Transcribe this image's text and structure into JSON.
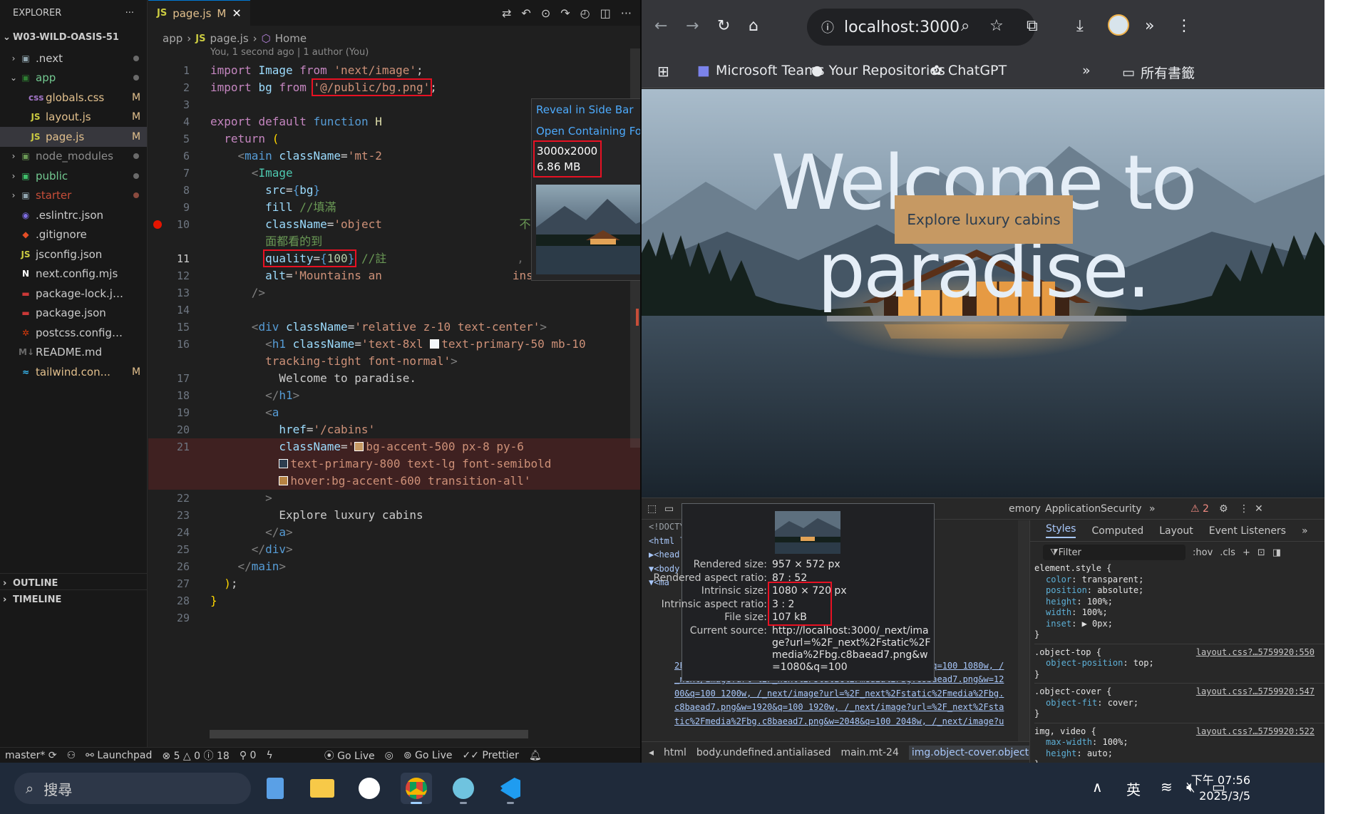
{
  "vscode": {
    "explorer": {
      "header": "EXPLORER",
      "project": "W03-WILD-OASIS-51",
      "items": [
        {
          "label": ".next",
          "icon": "folder",
          "indent": 1,
          "expanded": false,
          "status": "dot"
        },
        {
          "label": "app",
          "icon": "folder-app",
          "indent": 1,
          "expanded": true,
          "status": "dot",
          "color": "#73c991"
        },
        {
          "label": "globals.css",
          "icon": "css",
          "indent": 2,
          "status": "M",
          "color": "#e2c08d"
        },
        {
          "label": "layout.js",
          "icon": "js",
          "indent": 2,
          "status": "M",
          "color": "#e2c08d"
        },
        {
          "label": "page.js",
          "icon": "js",
          "indent": 2,
          "status": "M",
          "color": "#e2c08d",
          "active": true
        },
        {
          "label": "node_modules",
          "icon": "folder-node",
          "indent": 1,
          "expanded": false,
          "status": "dot",
          "color": "#8c8c8c"
        },
        {
          "label": "public",
          "icon": "folder-public",
          "indent": 1,
          "expanded": false,
          "status": "dot",
          "color": "#73c991"
        },
        {
          "label": "starter",
          "icon": "folder",
          "indent": 1,
          "expanded": false,
          "status": "dot",
          "color": "#c74e39"
        },
        {
          "label": ".eslintrc.json",
          "icon": "eslint",
          "indent": 1,
          "status": ""
        },
        {
          "label": ".gitignore",
          "icon": "git",
          "indent": 1,
          "status": ""
        },
        {
          "label": "jsconfig.json",
          "icon": "js",
          "indent": 1,
          "status": ""
        },
        {
          "label": "next.config.mjs",
          "icon": "next",
          "indent": 1,
          "status": ""
        },
        {
          "label": "package-lock.json",
          "icon": "npm",
          "indent": 1,
          "status": ""
        },
        {
          "label": "package.json",
          "icon": "npm",
          "indent": 1,
          "status": ""
        },
        {
          "label": "postcss.config.mjs",
          "icon": "postcss",
          "indent": 1,
          "status": ""
        },
        {
          "label": "README.md",
          "icon": "md",
          "indent": 1,
          "status": ""
        },
        {
          "label": "tailwind.con...",
          "icon": "tailwind",
          "indent": 1,
          "status": "M",
          "color": "#e2c08d"
        }
      ],
      "outline": "OUTLINE",
      "timeline": "TIMELINE"
    },
    "tab": {
      "icon": "JS",
      "name": "page.js",
      "status": "M"
    },
    "breadcrumb": {
      "folder": "app",
      "file_icon": "JS",
      "file": "page.js",
      "symbol": "Home"
    },
    "blame_header": "You, 1 second ago | 1 author (You)",
    "hover": {
      "link1": "Reveal in Side Bar",
      "link2": "Open Containing Folder",
      "dims": "3000x2000",
      "size": "6.86 MB"
    },
    "ghost_blame": "1 second ago",
    "statusbar": {
      "branch": "master*",
      "launchpad": "Launchpad",
      "errors": "5",
      "warnings": "0",
      "info": "18",
      "ports": "0",
      "golive1": "Go Live",
      "golive2": "Go Live",
      "prettier": "Prettier"
    }
  },
  "browser": {
    "url": "localhost:3000",
    "bookmarks": [
      "Microsoft Teams",
      "Your Repositories",
      "ChatGPT"
    ],
    "all_bookmarks": "所有書籤",
    "page": {
      "title": "Welcome to paradise.",
      "button": "Explore luxury cabins"
    },
    "devtools": {
      "tabs": [
        "emory",
        "Application",
        "Security"
      ],
      "warnings": "2",
      "side_tabs": [
        "Styles",
        "Computed",
        "Layout",
        "Event Listeners"
      ],
      "filter": "Filter",
      "hov": ":hov",
      "cls": ".cls",
      "tooltip": {
        "rendered_size_label": "Rendered size:",
        "rendered_size": "957 × 572 px",
        "rendered_ratio_label": "Rendered aspect ratio:",
        "rendered_ratio": "87 : 52",
        "intrinsic_size_label": "Intrinsic size:",
        "intrinsic_size": "1080 × 720 px",
        "intrinsic_ratio_label": "Intrinsic aspect ratio:",
        "intrinsic_ratio": "3 : 2",
        "file_size_label": "File size:",
        "file_size": "107 kB",
        "current_source_label": "Current source:",
        "current_source": "http://localhost:3000/_next/image?url=%2F_next%2Fstatic%2Fmedia%2Fbg.c8baead7.png&w=1080&q=100"
      },
      "dom_rows": [
        "<!DOCTY",
        "<html l",
        "▶<head",
        "▼<body",
        "  ▼<ma"
      ],
      "srcset_lines": [
        "2F_next%2Fstatic%2Fmedia%2Fbg.c8baead7.png&w=1080&q=100 1080w, /",
        "_next/image?url=%2F_next%2Fstatic%2Fmedia%2Fbg.c8baead7.png&w=12",
        "00&q=100 1200w, /_next/image?url=%2F_next%2Fstatic%2Fmedia%2Fbg.",
        "c8baead7.png&w=1920&q=100 1920w, /_next/image?url=%2F_next%2Fsta",
        "tic%2Fmedia%2Fbg.c8baead7.png&w=2048&q=100 2048w, /_next/image?u"
      ],
      "crumbs": [
        "html",
        "body.undefined.antialiased",
        "main.mt-24",
        "img.object-cover.object-top"
      ],
      "styles": [
        {
          "selector": "element.style {",
          "props": [
            [
              "color",
              "transparent"
            ],
            [
              "position",
              "absolute"
            ],
            [
              "height",
              "100%"
            ],
            [
              "width",
              "100%"
            ],
            [
              "inset",
              "▶ 0px"
            ]
          ],
          "source": ""
        },
        {
          "selector": ".object-top {",
          "props": [
            [
              "object-position",
              "top"
            ]
          ],
          "source": "layout.css?…5759920:550"
        },
        {
          "selector": ".object-cover {",
          "props": [
            [
              "object-fit",
              "cover"
            ]
          ],
          "source": "layout.css?…5759920:547"
        },
        {
          "selector": "img, video {",
          "props": [
            [
              "max-width",
              "100%"
            ],
            [
              "height",
              "auto"
            ]
          ],
          "source": "layout.css?…5759920:522"
        }
      ]
    }
  },
  "taskbar": {
    "search": "搜尋",
    "ime": "英",
    "time": "下午 07:56",
    "date": "2025/3/5"
  }
}
